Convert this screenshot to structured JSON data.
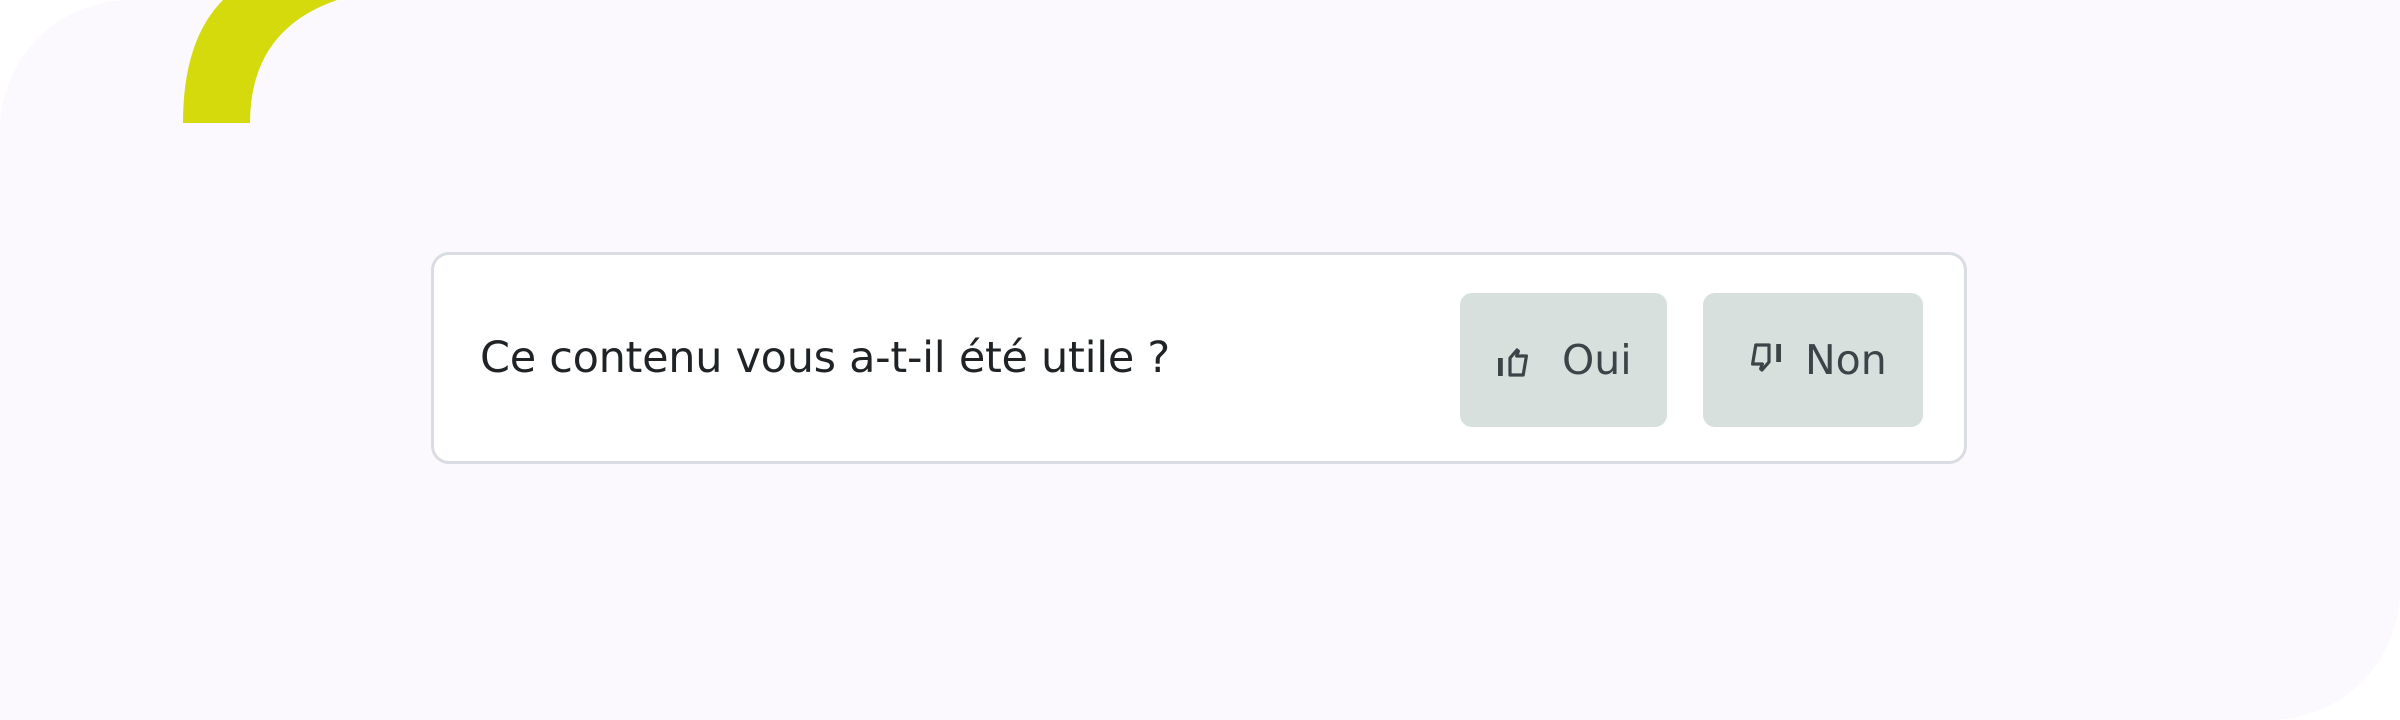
{
  "feedback": {
    "question": "Ce contenu vous a-t-il été utile ?",
    "yes_label": "Oui",
    "no_label": "Non",
    "yes_icon": "thumbs-up-icon",
    "no_icon": "thumbs-down-icon"
  },
  "colors": {
    "page_background": "#fbf9fd",
    "accent_arc": "#d4da0b",
    "card_background": "#ffffff",
    "card_border": "#d9dde3",
    "button_background": "#d8e0de",
    "button_text": "#3b4548",
    "question_text": "#1f2326"
  }
}
